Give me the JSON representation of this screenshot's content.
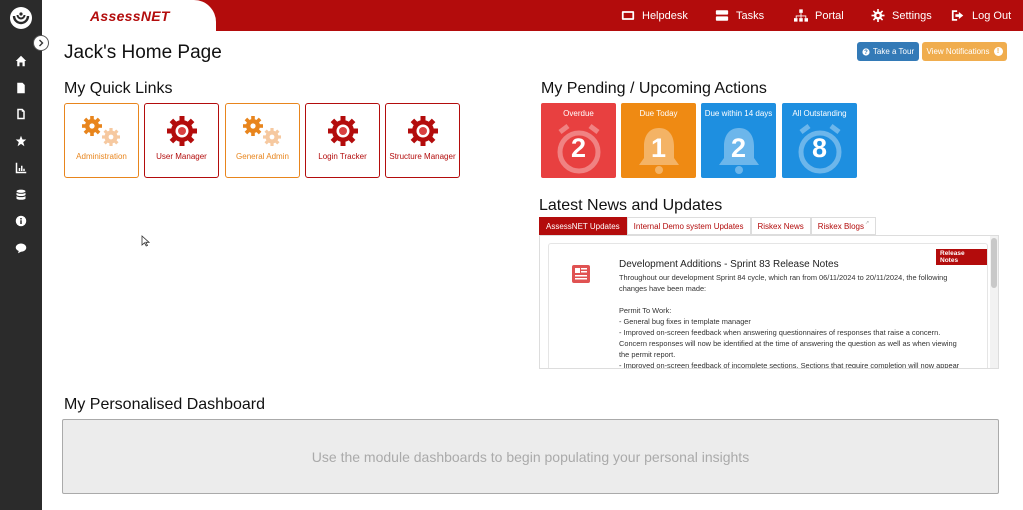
{
  "app": {
    "brand": "AssessNET",
    "brand_part1": "Assess",
    "brand_part2": "NET"
  },
  "topnav": [
    {
      "label": "Helpdesk",
      "icon": "helpdesk-icon"
    },
    {
      "label": "Tasks",
      "icon": "tasks-icon"
    },
    {
      "label": "Portal",
      "icon": "portal-icon"
    },
    {
      "label": "Settings",
      "icon": "gear-icon"
    },
    {
      "label": "Log Out",
      "icon": "logout-icon"
    }
  ],
  "sidebar": {
    "items": [
      {
        "icon": "home-icon"
      },
      {
        "icon": "document-icon"
      },
      {
        "icon": "file-icon"
      },
      {
        "icon": "star-icon"
      },
      {
        "icon": "chart-icon"
      },
      {
        "icon": "database-icon"
      },
      {
        "icon": "info-icon"
      },
      {
        "icon": "chat-icon"
      }
    ]
  },
  "page": {
    "title": "Jack's Home Page"
  },
  "header_buttons": {
    "tour": "Take a Tour",
    "notifications": "View Notifications",
    "notifications_count": "!"
  },
  "quick_links": {
    "title": "My Quick Links",
    "items": [
      {
        "label": "Administration",
        "color": "orange"
      },
      {
        "label": "User Manager",
        "color": "red"
      },
      {
        "label": "General Admin",
        "color": "orange"
      },
      {
        "label": "Login Tracker",
        "color": "red"
      },
      {
        "label": "Structure Manager",
        "color": "red"
      }
    ]
  },
  "pending": {
    "title": "My Pending / Upcoming Actions",
    "items": [
      {
        "label": "Overdue",
        "count": "2",
        "color": "#e84040"
      },
      {
        "label": "Due Today",
        "count": "1",
        "color": "#ef8a13"
      },
      {
        "label": "Due within 14 days",
        "count": "2",
        "color": "#1e8fe0"
      },
      {
        "label": "All Outstanding",
        "count": "8",
        "color": "#1e8fe0"
      }
    ]
  },
  "news": {
    "title": "Latest News and Updates",
    "tabs": [
      "AssessNET Updates",
      "Internal Demo system Updates",
      "Riskex News",
      "Riskex Blogs"
    ],
    "tab_external_mark": "↗",
    "badge": "Release Notes",
    "article_title": "Development Additions - Sprint 83 Release Notes",
    "article_intro": "Throughout our development Sprint 84 cycle, which ran from 06/11/2024 to 20/11/2024, the following changes have been made:",
    "article_section": "Permit To Work:",
    "article_lines": [
      "- General bug fixes in template manager",
      "- Improved on-screen feedback when answering questionnaires of responses that raise a concern. Concern responses will now be identified at the time of answering the question as well as when viewing the permit report.",
      "- Improved on-screen feedback of incomplete sections. Sections that require completion will now appear"
    ]
  },
  "dashboard": {
    "title": "My Personalised Dashboard",
    "placeholder": "Use the module dashboards to begin populating your personal insights"
  }
}
